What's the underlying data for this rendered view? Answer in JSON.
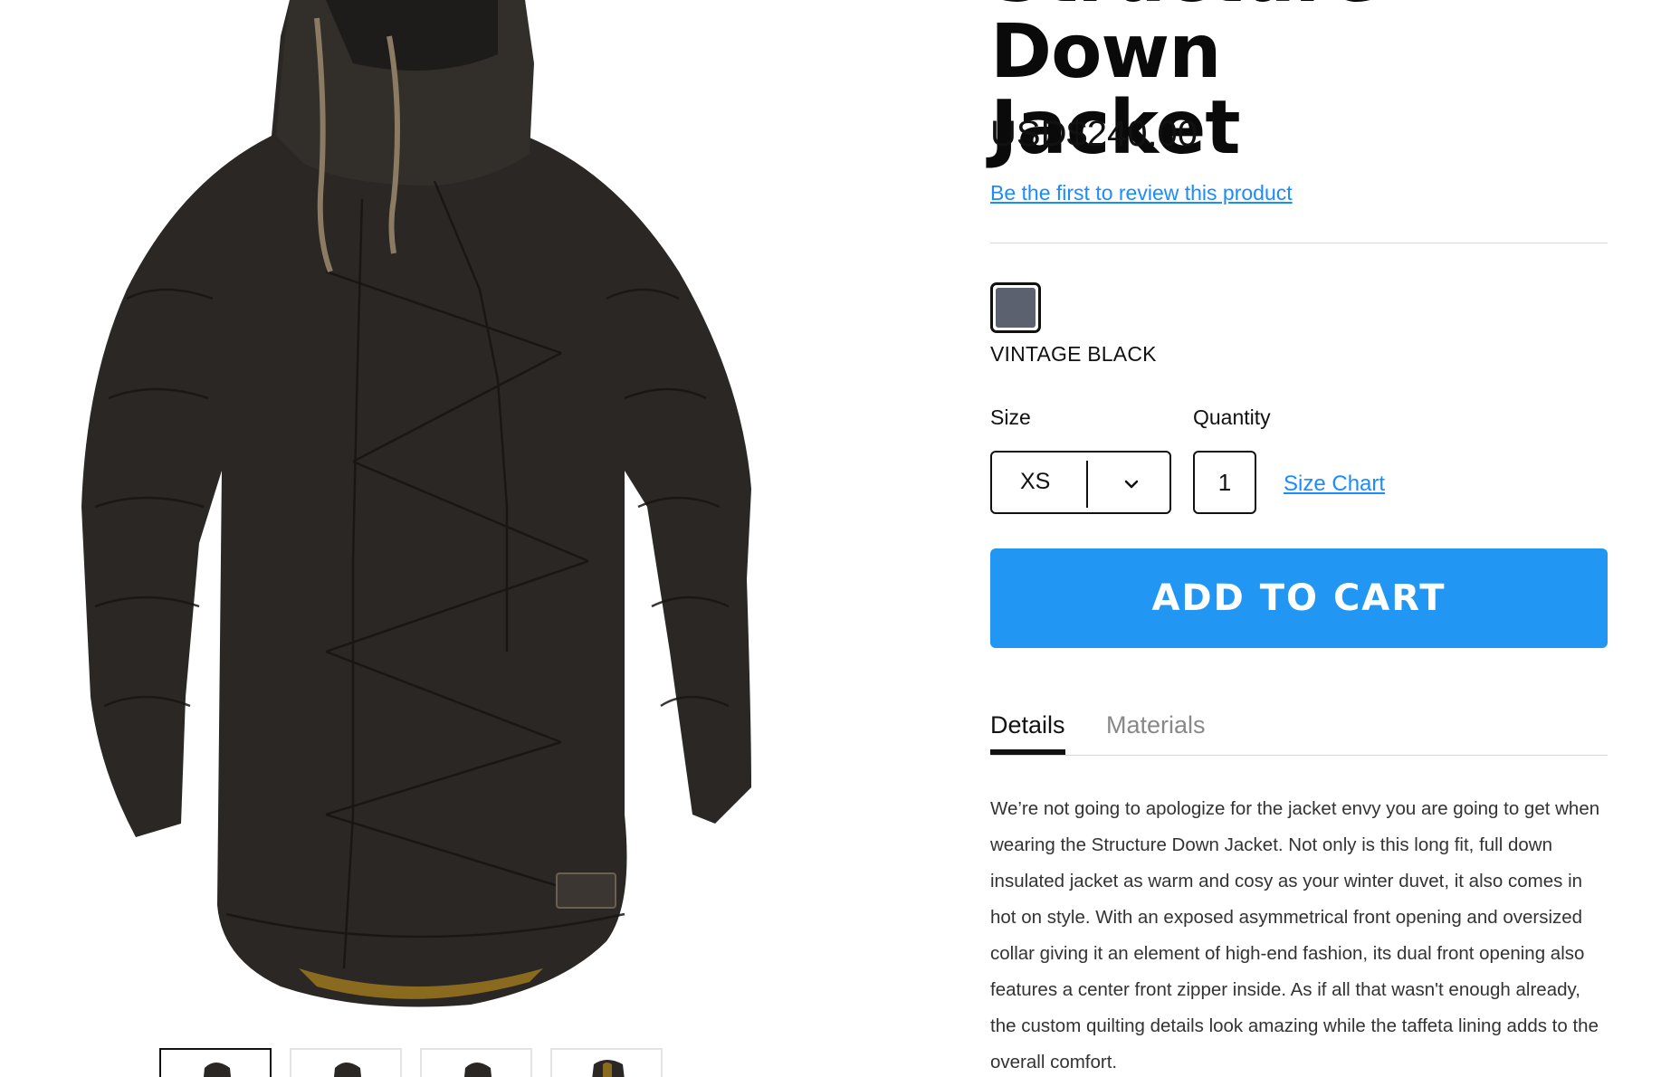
{
  "product": {
    "title": "Structure Down\nJacket",
    "price": "USD$240.00",
    "review_link": "Be the first to review this product",
    "color": {
      "name": "VINTAGE BLACK",
      "swatch_hex": "#5b616e",
      "selected": true
    },
    "size": {
      "label": "Size",
      "selected_value": "XS"
    },
    "quantity": {
      "label": "Quantity",
      "value": "1"
    },
    "size_chart_link": "Size Chart",
    "add_to_cart_label": "ADD TO CART",
    "tabs": [
      {
        "label": "Details",
        "active": true
      },
      {
        "label": "Materials",
        "active": false
      }
    ],
    "description": "We’re not going to apologize for the jacket envy you are going to get when wearing the Structure Down Jacket. Not only is this long fit, full down insulated jacket as warm and cosy as your winter duvet, it also comes in hot on style. With an exposed asymmetrical front opening and oversized collar giving it an element of high-end fashion, its dual front opening also features a center front zipper inside. As if all that wasn't enough already, the custom quilting details look amazing while the taffeta lining adds to the overall comfort."
  },
  "gallery": {
    "main_image": "black-down-jacket-photo",
    "thumbnails": [
      {
        "image": "jacket-front-thumbnail",
        "active": true
      },
      {
        "image": "jacket-back-thumbnail",
        "active": false
      },
      {
        "image": "jacket-side-thumbnail",
        "active": false
      },
      {
        "image": "jacket-detail-thumbnail",
        "active": false
      }
    ]
  },
  "colors": {
    "link": "#1a8cff",
    "cart_button": "#2196f3",
    "jacket": "#2a2724",
    "lining": "#8a6a1e"
  }
}
